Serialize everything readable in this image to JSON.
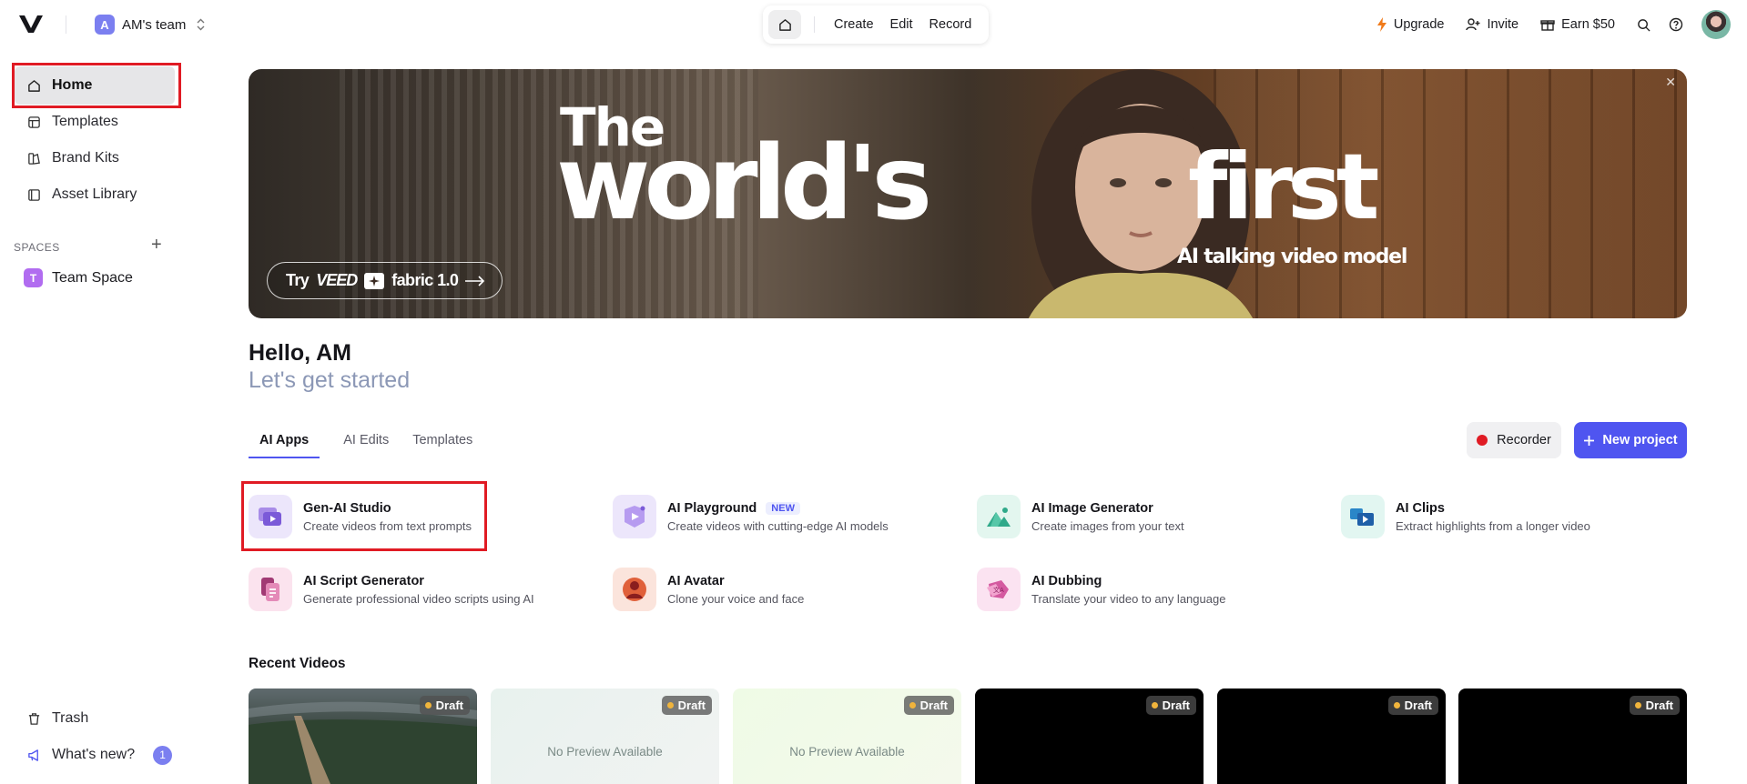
{
  "header": {
    "team_name": "AM's team",
    "team_initial": "A",
    "center_nav": [
      "Create",
      "Edit",
      "Record"
    ],
    "upgrade": "Upgrade",
    "invite": "Invite",
    "earn": "Earn $50"
  },
  "sidebar": {
    "items": [
      {
        "label": "Home",
        "icon": "home-icon"
      },
      {
        "label": "Templates",
        "icon": "templates-icon"
      },
      {
        "label": "Brand Kits",
        "icon": "brand-kits-icon"
      },
      {
        "label": "Asset Library",
        "icon": "asset-library-icon"
      }
    ],
    "spaces_label": "SPACES",
    "team_space": {
      "initial": "T",
      "label": "Team Space"
    },
    "trash": "Trash",
    "whats_new": "What's new?",
    "whats_new_count": "1"
  },
  "hero": {
    "line_the": "The",
    "line_world": "world's",
    "line_first": "first",
    "subtitle": "AI talking video model",
    "cta_prefix": "Try",
    "cta_brand": "VEED",
    "cta_product": "fabric 1.0"
  },
  "greeting": {
    "hello": "Hello, AM",
    "sub": "Let's get started"
  },
  "tabs": [
    "AI Apps",
    "AI Edits",
    "Templates"
  ],
  "actions": {
    "recorder": "Recorder",
    "new_project": "New project"
  },
  "apps": [
    {
      "title": "Gen-AI Studio",
      "desc": "Create videos from text prompts"
    },
    {
      "title": "AI Playground",
      "desc": "Create videos with cutting-edge AI models",
      "tag": "NEW"
    },
    {
      "title": "AI Image Generator",
      "desc": "Create images from your text"
    },
    {
      "title": "AI Clips",
      "desc": "Extract highlights from a longer video"
    },
    {
      "title": "AI Script Generator",
      "desc": "Generate professional video scripts using AI"
    },
    {
      "title": "AI Avatar",
      "desc": "Clone your voice and face"
    },
    {
      "title": "AI Dubbing",
      "desc": "Translate your video to any language"
    }
  ],
  "recent": {
    "title": "Recent Videos",
    "draft_label": "Draft",
    "no_preview": "No Preview Available"
  },
  "colors": {
    "accent": "#4f55f0",
    "highlight_box": "#e01b24",
    "recorder_dot": "#e01b24",
    "subtitle_gray": "#8c98b6"
  }
}
